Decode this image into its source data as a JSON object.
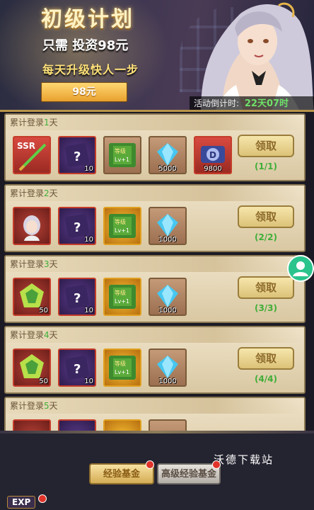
{
  "banner": {
    "title": "初级计划",
    "subtitle": "只需 投资98元",
    "tagline": "每天升级快人一步",
    "price_button": "98元",
    "timer_label": "活动倒计时:",
    "timer_value": "22天07时"
  },
  "rows": [
    {
      "head_prefix": "累计登录",
      "day": "1",
      "head_suffix": "天",
      "items": [
        {
          "icon": "ssr-weapon-icon",
          "qty": ""
        },
        {
          "icon": "mystery-item-icon",
          "qty": "10"
        },
        {
          "icon": "level-up-book-icon",
          "qty": ""
        },
        {
          "icon": "diamond-icon",
          "qty": "5000"
        },
        {
          "icon": "d-coin-icon",
          "qty": "9800"
        }
      ],
      "button": "领取",
      "progress": "(1/1)"
    },
    {
      "head_prefix": "累计登录",
      "day": "2",
      "head_suffix": "天",
      "items": [
        {
          "icon": "hero-portrait-icon",
          "qty": ""
        },
        {
          "icon": "mystery-item-icon",
          "qty": "10"
        },
        {
          "icon": "level-up-book-icon",
          "qty": ""
        },
        {
          "icon": "diamond-icon",
          "qty": "1000"
        }
      ],
      "button": "领取",
      "progress": "(2/2)"
    },
    {
      "head_prefix": "累计登录",
      "day": "3",
      "head_suffix": "天",
      "items": [
        {
          "icon": "green-gem-icon",
          "qty": "50"
        },
        {
          "icon": "mystery-item-icon",
          "qty": "10"
        },
        {
          "icon": "level-up-book-icon",
          "qty": ""
        },
        {
          "icon": "diamond-icon",
          "qty": "1000"
        }
      ],
      "button": "领取",
      "progress": "(3/3)"
    },
    {
      "head_prefix": "累计登录",
      "day": "4",
      "head_suffix": "天",
      "items": [
        {
          "icon": "green-gem-icon",
          "qty": "50"
        },
        {
          "icon": "mystery-item-icon",
          "qty": "10"
        },
        {
          "icon": "level-up-book-icon",
          "qty": ""
        },
        {
          "icon": "diamond-icon",
          "qty": "1000"
        }
      ],
      "button": "领取",
      "progress": "(4/4)"
    },
    {
      "head_prefix": "累计登录",
      "day": "5",
      "head_suffix": "天",
      "items": [],
      "button": "",
      "progress": ""
    }
  ],
  "level_book_text": "等级",
  "level_book_sub": "Lv+1",
  "ssr_text": "SSR",
  "tabs": {
    "exp_fund": "经验基金",
    "advanced_exp_fund": "高级经验基金"
  },
  "watermark": "沃德下载站",
  "exp_badge": "EXP"
}
